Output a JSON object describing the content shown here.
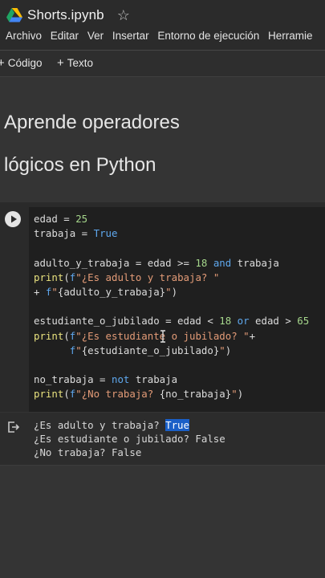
{
  "header": {
    "title": "Shorts.ipynb",
    "logo_icon": "google-drive-logo",
    "star_icon": "star-outline-icon",
    "menu": [
      "Archivo",
      "Editar",
      "Ver",
      "Insertar",
      "Entorno de ejecución",
      "Herramie"
    ]
  },
  "toolbar": {
    "code_label": "Código",
    "text_label": "Texto"
  },
  "markdown": {
    "heading_line1": "Aprende operadores",
    "heading_line2": "lógicos en Python"
  },
  "code_cell": {
    "lines": [
      "edad = 25",
      "trabaja = True",
      "",
      "adulto_y_trabaja = edad >= 18 and trabaja",
      "print(f\"¿Es adulto y trabaja? \"",
      "+ f\"{adulto_y_trabaja}\")",
      "",
      "estudiante_o_jubilado = edad < 18 or edad > 65",
      "print(f\"¿Es estudiante o jubilado? \"+",
      "      f\"{estudiante_o_jubilado}\")",
      "",
      "no_trabaja = not trabaja",
      "print(f\"¿No trabaja? {no_trabaja}\")"
    ]
  },
  "output": {
    "line1_text": "¿Es adulto y trabaja? ",
    "line1_value": "True",
    "line2": "¿Es estudiante o jubilado? False",
    "line3": "¿No trabaja? False"
  },
  "colors": {
    "keyword": "#5fa8ee",
    "function": "#e9e27e",
    "number": "#a6d78c",
    "string": "#e39b77",
    "selection": "#1a5fc7"
  }
}
